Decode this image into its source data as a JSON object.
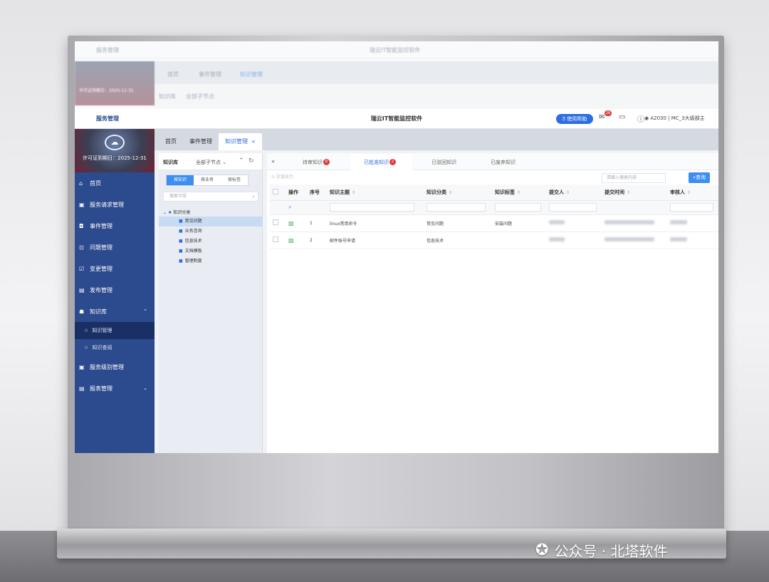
{
  "ghost": {
    "brand": "服务管理",
    "title": "瑞云IT智能监控软件",
    "tab_home": "首页",
    "tab_event": "事件管理",
    "tab_kb": "知识管理",
    "license": "许可证到期日：2025-12-31",
    "kb_label": "知识库",
    "select": "全部子节点"
  },
  "topbar": {
    "brand": "服务管理",
    "title": "瑞云IT智能监控软件",
    "help_label": "使用帮助",
    "msg_count": "26",
    "user": "A2030 | MC_3大级部主"
  },
  "sidebar": {
    "license": "许可证到期日：2025-12-31",
    "items": [
      {
        "icon": "home-icon",
        "glyph": "⌂",
        "label": "首页"
      },
      {
        "icon": "briefcase-icon",
        "glyph": "▣",
        "label": "服务请求管理"
      },
      {
        "icon": "event-icon",
        "glyph": "◘",
        "label": "事件管理"
      },
      {
        "icon": "problem-icon",
        "glyph": "⊡",
        "label": "问题管理"
      },
      {
        "icon": "change-icon",
        "glyph": "☑",
        "label": "变更管理"
      },
      {
        "icon": "release-icon",
        "glyph": "▤",
        "label": "发布管理"
      },
      {
        "icon": "knowledge-icon",
        "glyph": "☗",
        "label": "知识库"
      }
    ],
    "sub_items": [
      {
        "label": "知识管理"
      },
      {
        "label": "知识查阅"
      }
    ],
    "more_items": [
      {
        "label": "服务级别管理"
      },
      {
        "label": "报表管理"
      }
    ]
  },
  "tabs": [
    {
      "label": "首页"
    },
    {
      "label": "事件管理"
    },
    {
      "label": "知识管理"
    }
  ],
  "kb_panel": {
    "title": "知识库",
    "select": "全部子节点",
    "filters": [
      "按知识",
      "按业务",
      "按标签"
    ],
    "search_placeholder": "搜索字段",
    "root": "知识分类",
    "nodes": [
      {
        "label": "常见问题"
      },
      {
        "label": "业务咨询"
      },
      {
        "label": "信息技术"
      },
      {
        "label": "文档模板"
      },
      {
        "label": "管理制度"
      }
    ]
  },
  "subtabs": [
    {
      "label": "待审知识",
      "count": "8"
    },
    {
      "label": "已批准知识",
      "count": "2"
    },
    {
      "label": "已驳回知识"
    },
    {
      "label": "已废弃知识"
    }
  ],
  "toolbar": {
    "batch": "批量废弃",
    "search_placeholder": "请输入搜索内容",
    "query": "查询"
  },
  "table": {
    "headers": [
      "操作",
      "序号",
      "知识主题",
      "知识分类",
      "知识标签",
      "提交人",
      "提交时间",
      "审核人"
    ],
    "rows": [
      {
        "index": "1",
        "subject": "linux常用命令",
        "category": "常见问题",
        "tag": "安装问题"
      },
      {
        "index": "2",
        "subject": "邮件账号申请",
        "category": "信息技术",
        "tag": ""
      }
    ]
  },
  "watermark": {
    "text": "公众号 · 北塔软件"
  },
  "colors": {
    "accent": "#2d6ee0",
    "sidebar": "#2c4a8e",
    "badge": "#e23b3b"
  }
}
